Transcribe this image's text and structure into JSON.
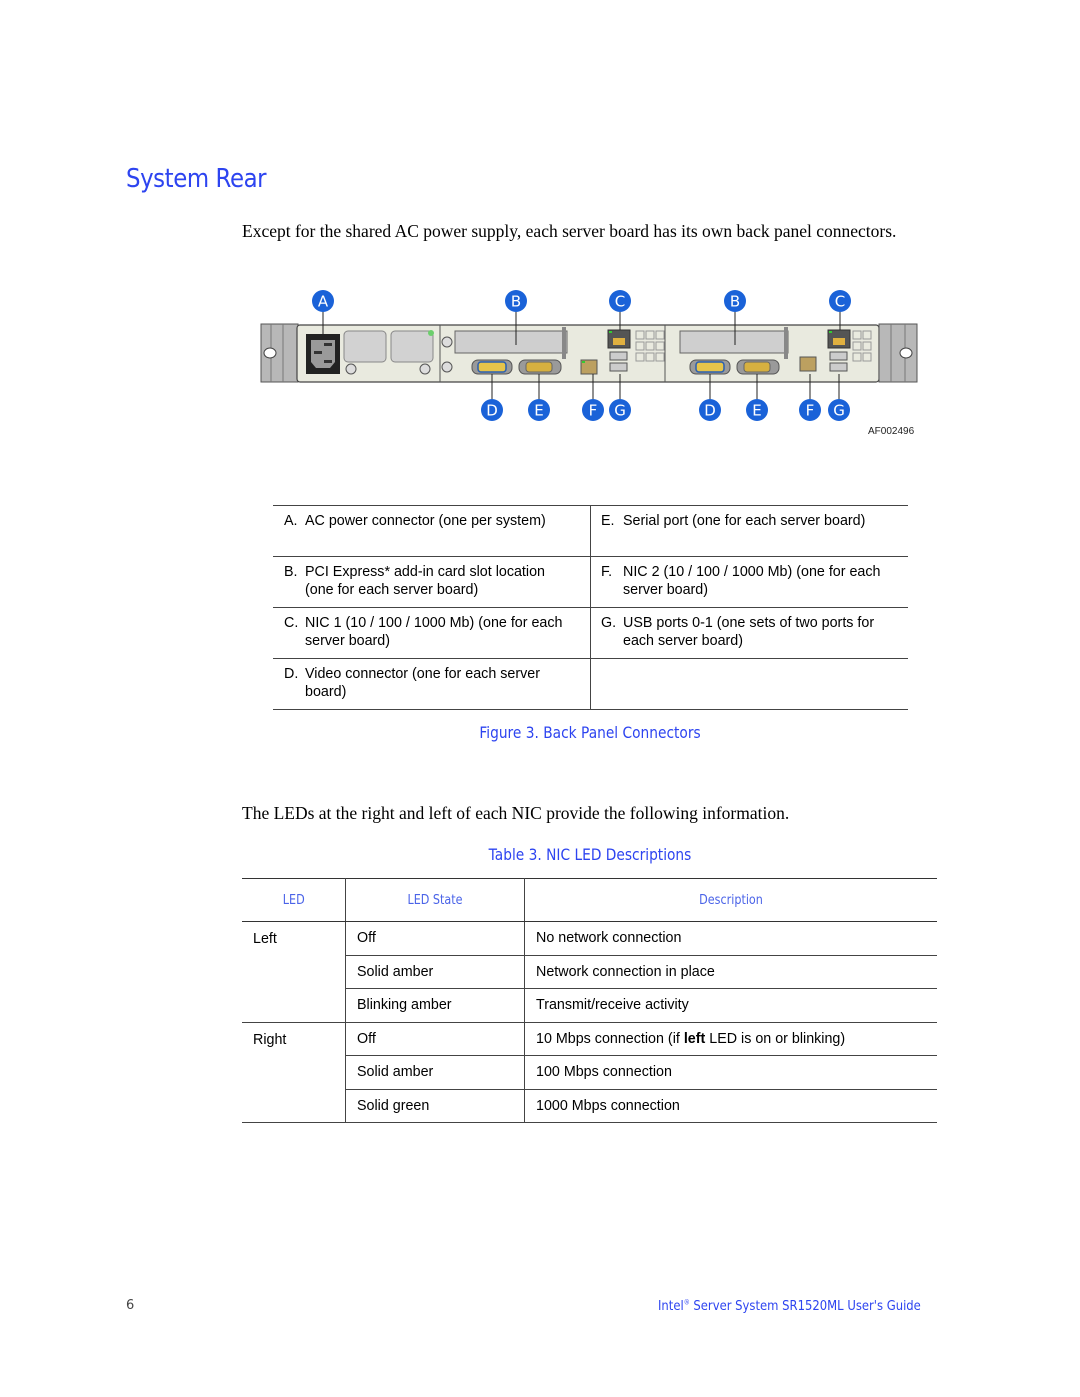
{
  "page": {
    "heading": "System Rear",
    "intro": "Except for the shared AC power supply, each server board has its own back panel connectors.",
    "figure": {
      "callouts_top": [
        "A",
        "B",
        "C",
        "B",
        "C"
      ],
      "callouts_bottom": [
        "D",
        "E",
        "F",
        "G",
        "D",
        "E",
        "F",
        "G"
      ],
      "figure_id": "AF002496",
      "caption": "Figure 3. Back Panel Connectors",
      "accent_color": "#1a62d8"
    },
    "legend": {
      "left": [
        {
          "letter": "A.",
          "text": "AC power connector (one per system)"
        },
        {
          "letter": "B.",
          "text": "PCI Express* add-in card slot location (one for each server board)"
        },
        {
          "letter": "C.",
          "text": "NIC 1 (10 / 100 / 1000 Mb) (one for each server board)"
        },
        {
          "letter": "D.",
          "text": "Video connector (one for each server board)"
        }
      ],
      "right": [
        {
          "letter": "E.",
          "text": "Serial port (one for each server board)"
        },
        {
          "letter": "F.",
          "text": "NIC 2 (10 / 100 / 1000 Mb) (one for each server board)"
        },
        {
          "letter": "G.",
          "text": "USB ports 0-1 (one sets of two ports for each server board)"
        },
        {
          "letter": "",
          "text": ""
        }
      ]
    },
    "paragraph2": "The LEDs at the right and left of each NIC provide the following information.",
    "table": {
      "caption": "Table 3. NIC LED Descriptions",
      "headers": [
        "LED",
        "LED State",
        "Description"
      ],
      "groups": [
        {
          "led": "Left",
          "rows": [
            {
              "state": "Off",
              "desc": "No network connection"
            },
            {
              "state": "Solid amber",
              "desc": "Network connection in place"
            },
            {
              "state": "Blinking amber",
              "desc": "Transmit/receive activity"
            }
          ]
        },
        {
          "led": "Right",
          "rows": [
            {
              "state": "Off",
              "desc_pre": "10 Mbps connection (if ",
              "desc_bold": "left",
              "desc_post": " LED is on or blinking)"
            },
            {
              "state": "Solid amber",
              "desc": "100 Mbps connection"
            },
            {
              "state": "Solid green",
              "desc": "1000 Mbps connection"
            }
          ]
        }
      ]
    },
    "footer": {
      "page_number": "6",
      "brand": "Intel",
      "trademark": "®",
      "title_rest": " Server System SR1520ML User's Guide"
    },
    "colors": {
      "heading": "#2d44f0",
      "table_header": "#4a63e8"
    }
  }
}
